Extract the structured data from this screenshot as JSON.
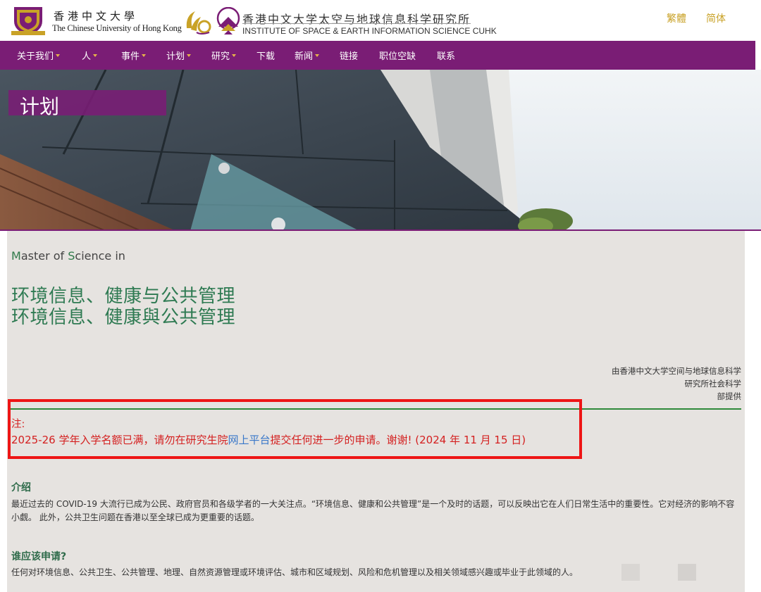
{
  "header": {
    "cuhk_name_zh": "香港中文大學",
    "cuhk_name_en": "The Chinese University of Hong Kong",
    "issc_name_zh": "香港中文大学太空与地球信息科学研究所",
    "issc_name_en": "INSTITUTE OF SPACE & EARTH INFORMATION SCIENCE   CUHK",
    "lang_traditional": "繁體",
    "lang_simplified": "简体"
  },
  "nav": {
    "items": [
      {
        "label": "关于我们",
        "dropdown": true
      },
      {
        "label": "人",
        "dropdown": true
      },
      {
        "label": "事件",
        "dropdown": true
      },
      {
        "label": "计划",
        "dropdown": true
      },
      {
        "label": "研究",
        "dropdown": true
      },
      {
        "label": "下载",
        "dropdown": false
      },
      {
        "label": "新闻",
        "dropdown": true
      },
      {
        "label": "链接",
        "dropdown": false
      },
      {
        "label": "职位空缺",
        "dropdown": false
      },
      {
        "label": "联系",
        "dropdown": false
      }
    ]
  },
  "banner": {
    "title": "计划"
  },
  "program": {
    "prefix_M": "M",
    "prefix_mid": "aster of ",
    "prefix_S": "S",
    "prefix_end": "cience in",
    "title_simplified": "环境信息、健康与公共管理",
    "title_traditional": "环境信息、健康與公共管理",
    "provider_lines": [
      "由香港中文大学空间与地球信息科学",
      "研究所社会科学",
      "部提供"
    ]
  },
  "notice": {
    "label": "注:",
    "text_before": "2025-26 学年入学名额已满，请勿在研究生院",
    "link_text": "网上平台",
    "text_after": "提交任何进一步的申请。谢谢!  (2024 年 11 月 15 日)"
  },
  "sections": {
    "intro_heading": "介绍",
    "intro_text": "最近过去的 COVID-19 大流行已成为公民、政府官员和各级学者的一大关注点。“环境信息、健康和公共管理”是一个及时的话题，可以反映出它在人们日常生活中的重要性。它对经济的影响不容小觑。 此外，公共卫生问题在香港以至全球已成为更重要的话题。",
    "who_heading": "谁应该申请?",
    "who_text": "任何对环境信息、公共卫生、公共管理、地理、自然资源管理或环境评估、城市和区域规划、风险和危机管理以及相关领域感兴趣或毕业于此领域的人。"
  },
  "colors": {
    "brand_purple": "#7a1d75",
    "accent_gold": "#c9a227",
    "program_green": "#2e7a52",
    "notice_red": "#d42020",
    "highlight_red": "#ee1515",
    "link_blue": "#3a78c9"
  }
}
